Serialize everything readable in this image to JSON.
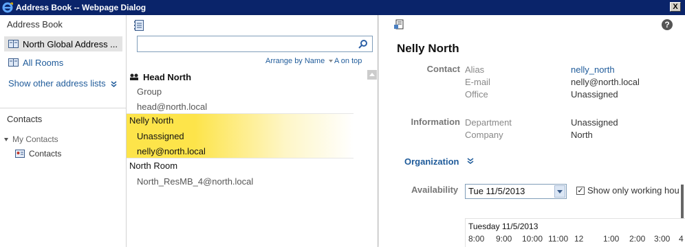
{
  "window": {
    "title": "Address Book -- Webpage Dialog",
    "close_label": "X"
  },
  "left": {
    "header": "Address Book",
    "lists": [
      {
        "label": "North Global Address ...",
        "selected": true
      },
      {
        "label": "All Rooms",
        "selected": false
      }
    ],
    "show_other": "Show other address lists",
    "contacts_header": "Contacts",
    "my_contacts": "My Contacts",
    "contacts_folder": "Contacts"
  },
  "middle": {
    "search": {
      "value": "",
      "placeholder": ""
    },
    "arrange_label": "Arrange by Name",
    "order_label": "A on top",
    "group_header": "Head North",
    "entries": [
      {
        "line1": "Group",
        "line2": "head@north.local"
      },
      {
        "name": "Nelly North",
        "office": "Unassigned",
        "email": "nelly@north.local"
      },
      {
        "name": "North Room",
        "email": "North_ResMB_4@north.local"
      }
    ]
  },
  "details": {
    "name": "Nelly North",
    "contact_section": "Contact",
    "contact_fields": [
      {
        "label": "Alias",
        "value": "nelly_north",
        "link": true
      },
      {
        "label": "E-mail",
        "value": "nelly@north.local",
        "link": false
      },
      {
        "label": "Office",
        "value": "Unassigned",
        "link": false
      }
    ],
    "information_section": "Information",
    "information_fields": [
      {
        "label": "Department",
        "value": "Unassigned"
      },
      {
        "label": "Company",
        "value": "North"
      }
    ],
    "organization": "Organization",
    "availability_label": "Availability",
    "date_value": "Tue 11/5/2013",
    "working_hours_label": "Show only working hou",
    "working_hours_checked": true,
    "schedule_date": "Tuesday 11/5/2013",
    "hours": [
      "8:00",
      "9:00",
      "10:00",
      "11:00",
      "12",
      "1:00",
      "2:00",
      "3:00",
      "4"
    ]
  },
  "colors": {
    "titlebar": "#0a246a",
    "link": "#1f5b9a",
    "highlight": "#fde44a"
  }
}
